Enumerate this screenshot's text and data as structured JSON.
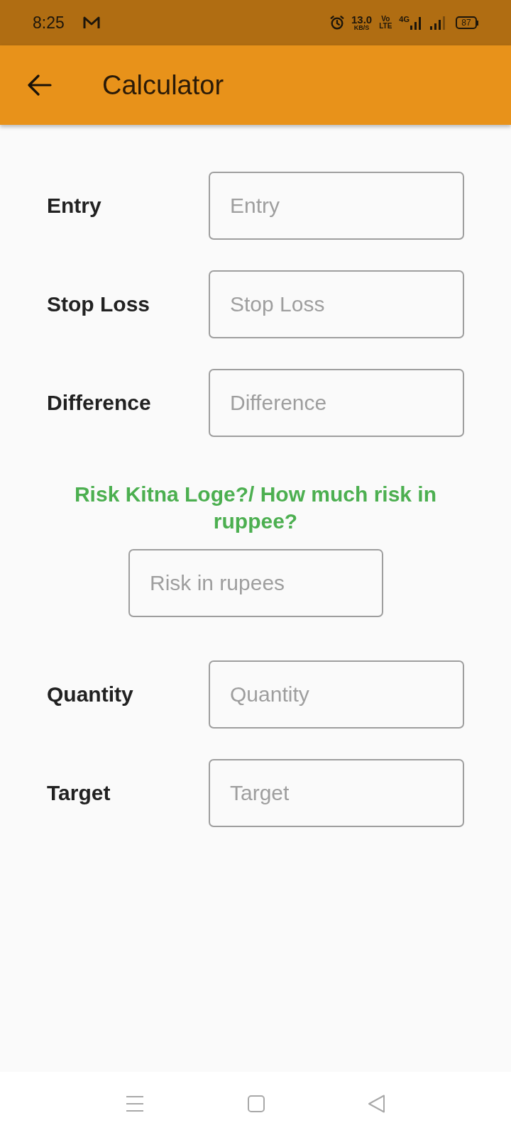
{
  "status_bar": {
    "time": "8:25",
    "data_rate": "13.0",
    "data_rate_unit": "KB/S",
    "volte_top": "Vo",
    "volte_bottom": "LTE",
    "network": "4G",
    "battery": "87"
  },
  "app_bar": {
    "title": "Calculator"
  },
  "fields_top": [
    {
      "label": "Entry",
      "placeholder": "Entry"
    },
    {
      "label": "Stop Loss",
      "placeholder": "Stop Loss"
    },
    {
      "label": "Difference",
      "placeholder": "Difference"
    }
  ],
  "risk": {
    "prompt": "Risk Kitna Loge?/ How much risk in ruppee?",
    "placeholder": "Risk in rupees"
  },
  "fields_bottom": [
    {
      "label": "Quantity",
      "placeholder": "Quantity"
    },
    {
      "label": "Target",
      "placeholder": "Target"
    }
  ]
}
